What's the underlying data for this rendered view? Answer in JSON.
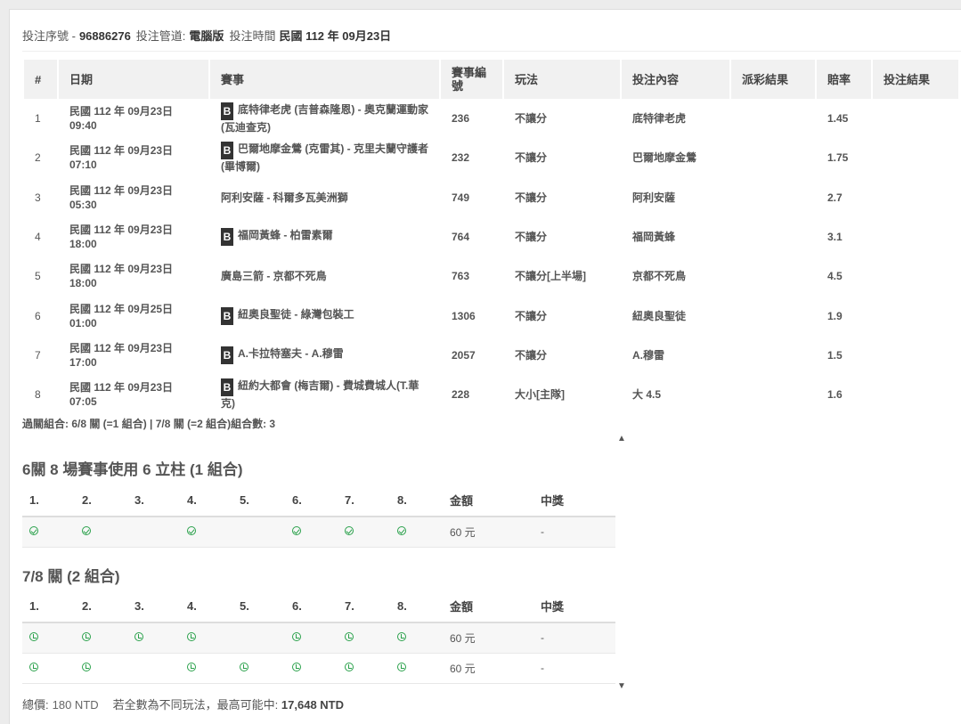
{
  "header": {
    "serial_label": "投注序號 -",
    "serial_value": "96886276",
    "channel_label": "投注管道:",
    "channel_value": "電腦版",
    "time_label": "投注時間",
    "time_value": "民國 112 年 09月23日"
  },
  "bets_table": {
    "columns": [
      "#",
      "日期",
      "賽事",
      "賽事編號",
      "玩法",
      "投注內容",
      "派彩結果",
      "賠率",
      "投注結果"
    ],
    "rows": [
      {
        "no": "1",
        "date": "民國 112 年 09月23日",
        "time": "09:40",
        "badge": "B",
        "event": "底特律老虎 (吉普森隆恩) - 奧克蘭運動家(瓦迪查克)",
        "event_no": "236",
        "play": "不讓分",
        "pick": "底特律老虎",
        "payout": "",
        "odds": "1.45",
        "result": ""
      },
      {
        "no": "2",
        "date": "民國 112 年 09月23日",
        "time": "07:10",
        "badge": "B",
        "event": "巴爾地摩金鶯 (克雷其) - 克里夫蘭守護者(畢博爾)",
        "event_no": "232",
        "play": "不讓分",
        "pick": "巴爾地摩金鶯",
        "payout": "",
        "odds": "1.75",
        "result": ""
      },
      {
        "no": "3",
        "date": "民國 112 年 09月23日",
        "time": "05:30",
        "badge": "",
        "event": "阿利安薩 - 科爾多瓦美洲獅",
        "event_no": "749",
        "play": "不讓分",
        "pick": "阿利安薩",
        "payout": "",
        "odds": "2.7",
        "result": ""
      },
      {
        "no": "4",
        "date": "民國 112 年 09月23日",
        "time": "18:00",
        "badge": "B",
        "event": "福岡黃蜂 - 柏雷素爾",
        "event_no": "764",
        "play": "不讓分",
        "pick": "福岡黃蜂",
        "payout": "",
        "odds": "3.1",
        "result": ""
      },
      {
        "no": "5",
        "date": "民國 112 年 09月23日",
        "time": "18:00",
        "badge": "",
        "event": "廣島三箭 - 京都不死鳥",
        "event_no": "763",
        "play": "不讓分[上半場]",
        "pick": "京都不死鳥",
        "payout": "",
        "odds": "4.5",
        "result": ""
      },
      {
        "no": "6",
        "date": "民國 112 年 09月25日",
        "time": "01:00",
        "badge": "B",
        "event": "紐奧良聖徒 - 綠灣包裝工",
        "event_no": "1306",
        "play": "不讓分",
        "pick": "紐奧良聖徒",
        "payout": "",
        "odds": "1.9",
        "result": ""
      },
      {
        "no": "7",
        "date": "民國 112 年 09月23日",
        "time": "17:00",
        "badge": "B",
        "event": "A.卡拉特塞夫 - A.穆雷",
        "event_no": "2057",
        "play": "不讓分",
        "pick": "A.穆雷",
        "payout": "",
        "odds": "1.5",
        "result": ""
      },
      {
        "no": "8",
        "date": "民國 112 年 09月23日",
        "time": "07:05",
        "badge": "B",
        "event": "紐約大都會 (梅吉爾) - 費城費城人(T.華克)",
        "event_no": "228",
        "play": "大小[主隊]",
        "pick": "大 4.5",
        "payout": "",
        "odds": "1.6",
        "result": ""
      }
    ]
  },
  "combo_summary": "過關組合: 6/8 關 (=1 組合) | 7/8 關 (=2 組合)組合數: 3",
  "sections": [
    {
      "title": "6關 8 場賽事使用 6 立柱 (1 組合)",
      "columns": [
        "1.",
        "2.",
        "3.",
        "4.",
        "5.",
        "6.",
        "7.",
        "8.",
        "金額",
        "中獎"
      ],
      "rows": [
        {
          "marks": [
            "check",
            "check",
            "",
            "check",
            "",
            "check",
            "check",
            "check"
          ],
          "amount": "60 元",
          "win": "-"
        }
      ]
    },
    {
      "title": "7/8 關 (2 組合)",
      "columns": [
        "1.",
        "2.",
        "3.",
        "4.",
        "5.",
        "6.",
        "7.",
        "8.",
        "金額",
        "中獎"
      ],
      "rows": [
        {
          "marks": [
            "pending",
            "pending",
            "pending",
            "pending",
            "",
            "pending",
            "pending",
            "pending"
          ],
          "amount": "60 元",
          "win": "-"
        },
        {
          "marks": [
            "pending",
            "pending",
            "",
            "pending",
            "pending",
            "pending",
            "pending",
            "pending"
          ],
          "amount": "60 元",
          "win": "-"
        }
      ]
    }
  ],
  "footer": {
    "total_label": "總價:",
    "total_value": "180 NTD",
    "max_label": "若全數為不同玩法，最高可能中:",
    "max_value": "17,648 NTD"
  },
  "icons": {
    "check": "check-circle-icon",
    "pending": "clock-circle-icon",
    "scroll_up": "chevron-up-icon",
    "scroll_down": "chevron-down-icon"
  },
  "colors": {
    "accent_green": "#2aa14b",
    "header_bg": "#f1f1f1",
    "badge_bg": "#333333"
  }
}
